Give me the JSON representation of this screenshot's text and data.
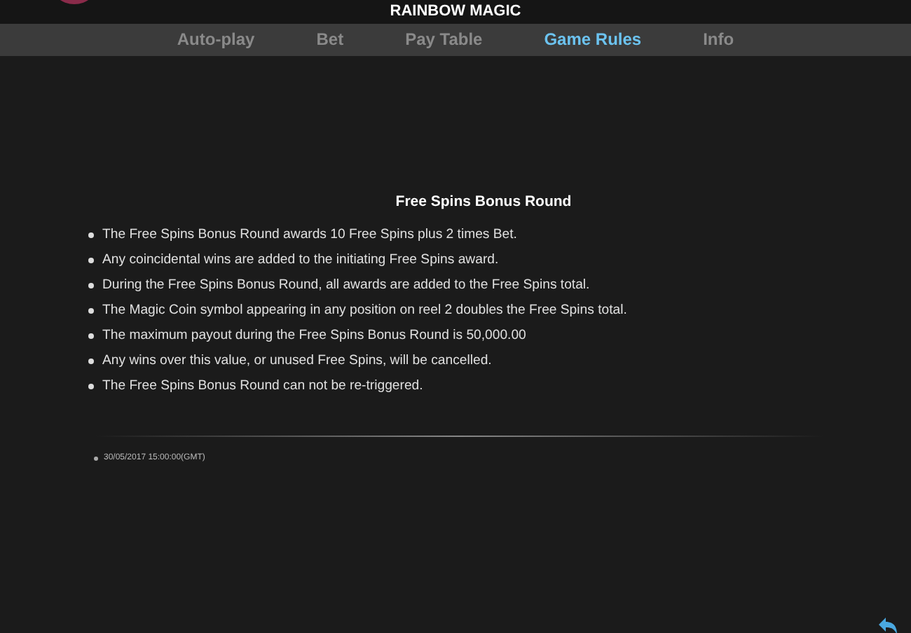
{
  "header": {
    "title": "RAINBOW MAGIC"
  },
  "tabs": [
    {
      "label": "Auto-play",
      "selected": false
    },
    {
      "label": "Bet",
      "selected": false
    },
    {
      "label": "Pay Table",
      "selected": false
    },
    {
      "label": "Game Rules",
      "selected": true
    },
    {
      "label": "Info",
      "selected": false
    }
  ],
  "section": {
    "heading": "Free Spins Bonus Round",
    "rules": [
      "The Free Spins Bonus Round awards 10 Free Spins plus 2 times Bet.",
      "Any coincidental wins are added to the initiating Free Spins award.",
      "During the Free Spins Bonus Round, all awards are added to the Free Spins total.",
      "The Magic Coin symbol appearing in any position on reel 2 doubles the Free Spins total.",
      "The maximum payout during the Free Spins Bonus Round is 50,000.00",
      "Any wins over this value, or unused Free Spins, will be cancelled.",
      "The Free Spins Bonus Round can not be re-triggered."
    ]
  },
  "footer": {
    "date": "30/05/2017 15:00:00(GMT)"
  }
}
